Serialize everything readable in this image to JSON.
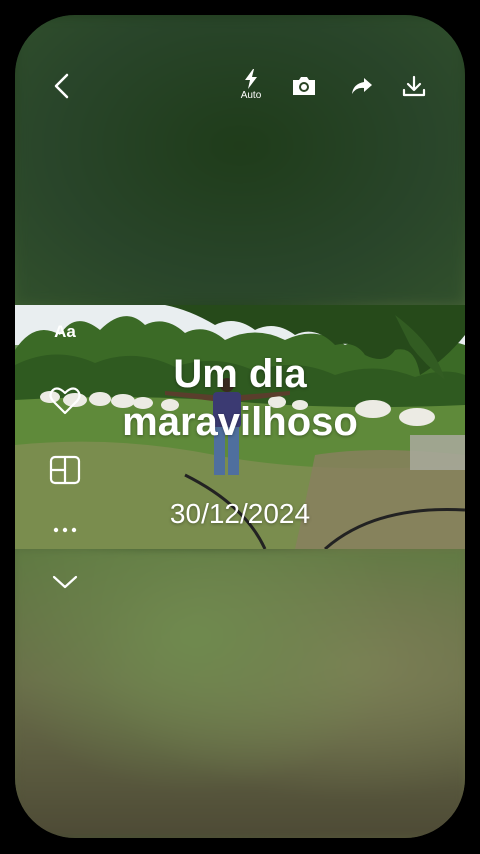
{
  "toolbar": {
    "back_icon": "back-arrow-icon",
    "flash_label": "Auto",
    "flash_icon": "flash-icon",
    "camera_icon": "camera-icon",
    "share_icon": "share-icon",
    "download_icon": "download-icon"
  },
  "overlay": {
    "title_line1": "Um dia",
    "title_line2": "maravilhoso",
    "date": "30/12/2024"
  },
  "side_tools": {
    "text_style_label": "Aa",
    "favorite_icon": "heart-icon",
    "layout_icon": "layout-icon",
    "more_icon": "more-icon",
    "collapse_icon": "chevron-down-icon"
  },
  "colors": {
    "background": "#000000",
    "icon": "#ffffff",
    "blur_green_dark": "#233e1f",
    "blur_green_light": "#6f7a4a"
  }
}
